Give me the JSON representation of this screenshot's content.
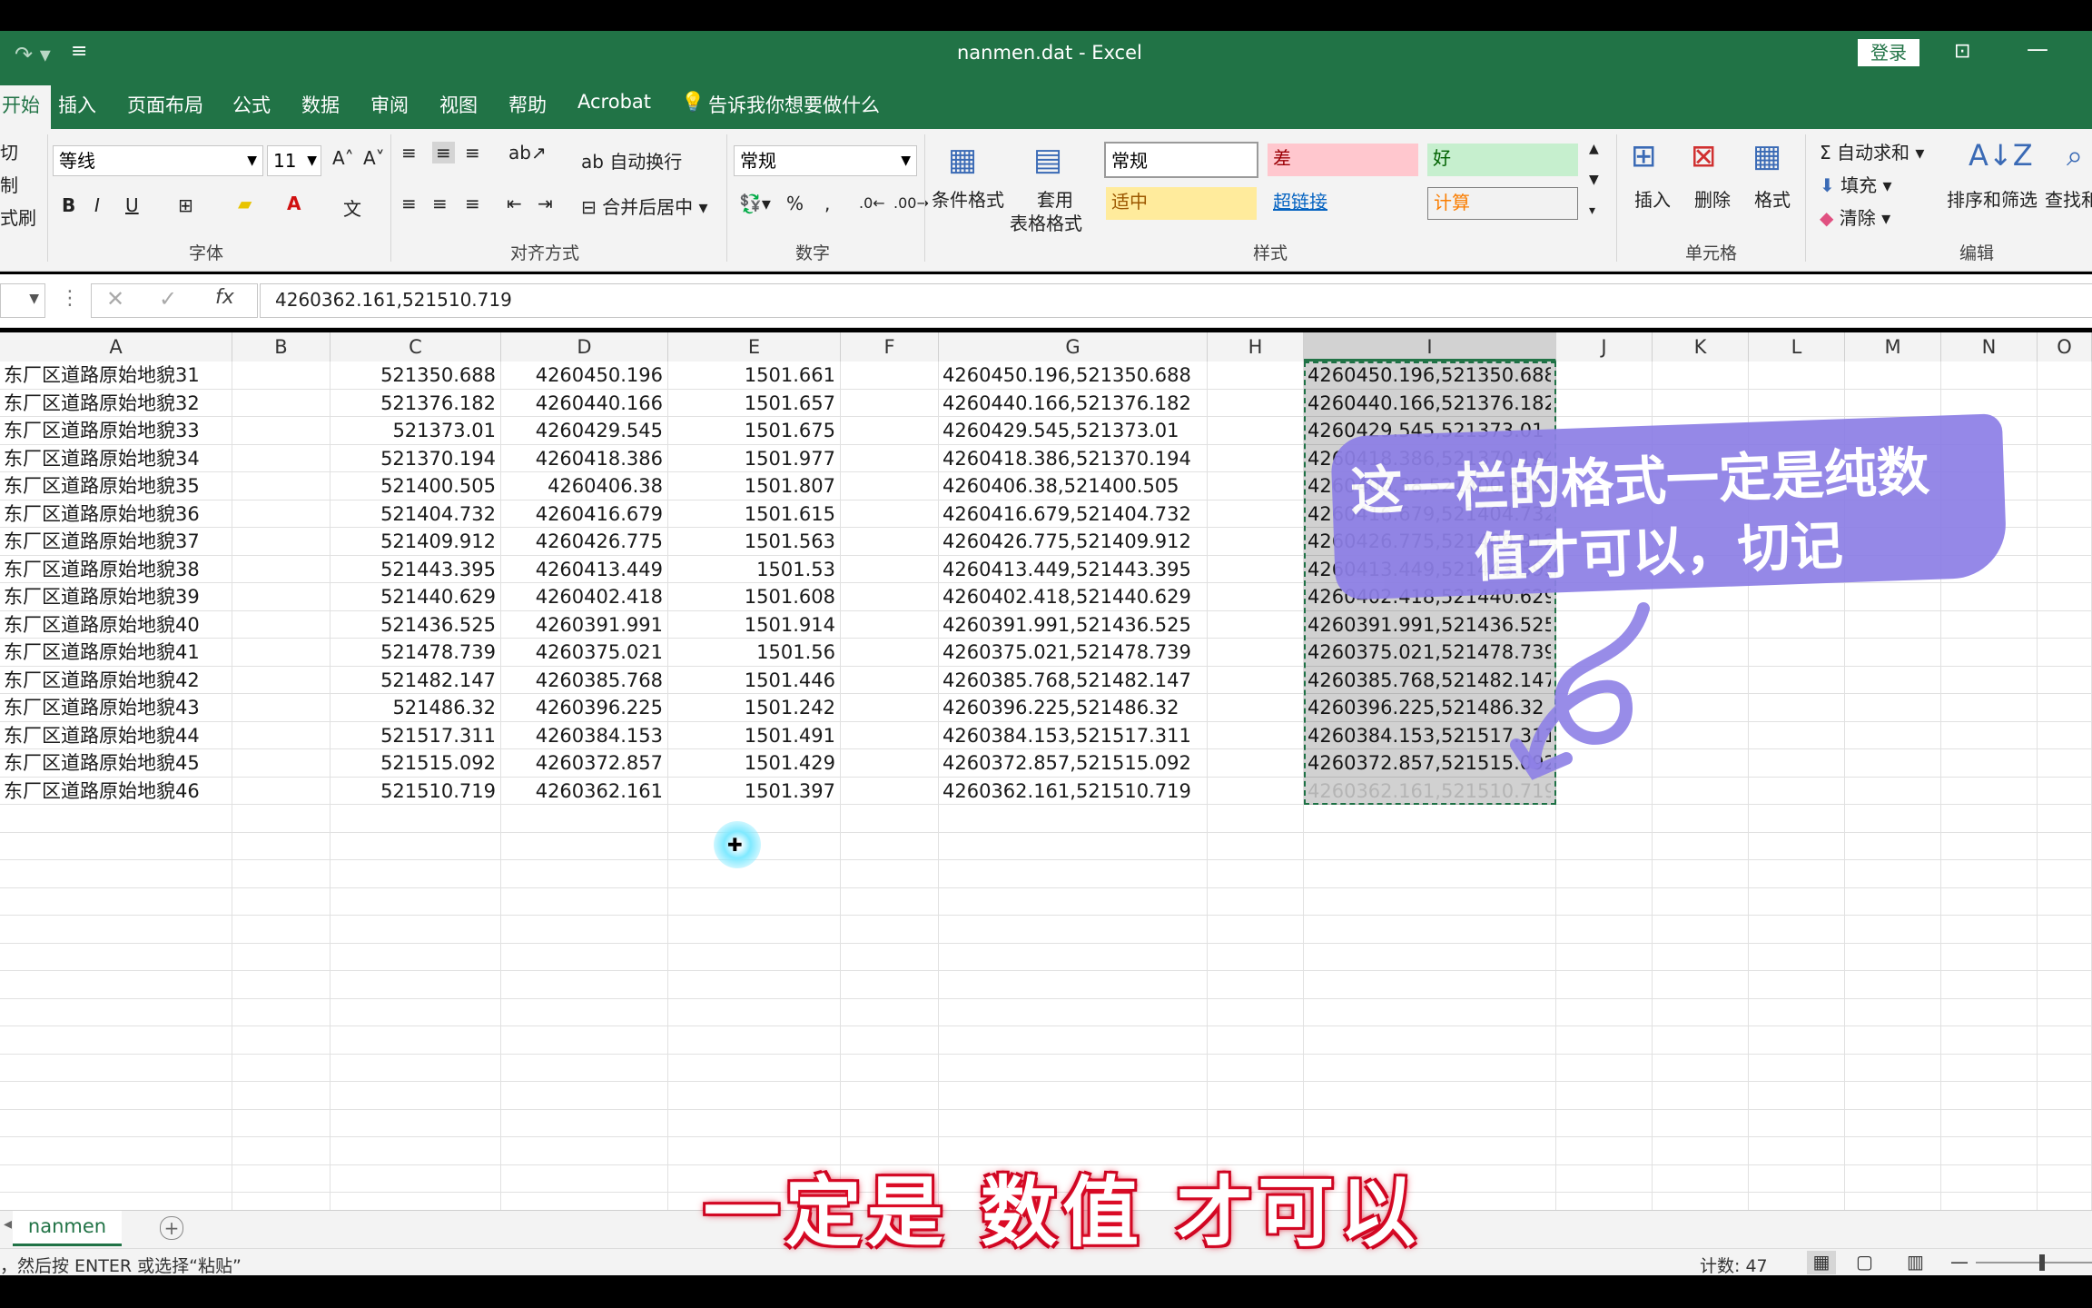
{
  "window": {
    "title": "nanmen.dat  -  Excel",
    "login": "登录"
  },
  "menu": {
    "items": [
      "开始",
      "插入",
      "页面布局",
      "公式",
      "数据",
      "审阅",
      "视图",
      "帮助",
      "Acrobat"
    ],
    "tellme": "告诉我你想要做什么"
  },
  "ribbon": {
    "clipboard": {
      "cut": "切",
      "copy": "制",
      "format_painter": "式刷"
    },
    "font": {
      "name": "等线",
      "size": "11",
      "label": "字体",
      "bold": "B",
      "italic": "I",
      "underline": "U"
    },
    "align": {
      "wrap": "自动换行",
      "merge": "合并后居中",
      "label": "对齐方式"
    },
    "number": {
      "format": "常规",
      "percent": "%",
      "comma": ",",
      "label": "数字"
    },
    "styles": {
      "conditional": "条件格式",
      "table_line1": "套用",
      "table_line2": "表格格式",
      "label": "样式",
      "cells": [
        "常规",
        "差",
        "好",
        "适中",
        "超链接",
        "计算"
      ]
    },
    "cells": {
      "insert": "插入",
      "delete": "删除",
      "format": "格式",
      "label": "单元格"
    },
    "editing": {
      "autosum": "自动求和",
      "fill": "填充",
      "clear": "清除",
      "sort": "排序和筛选",
      "find": "查找和",
      "label": "编辑"
    }
  },
  "formula": {
    "fx": "fx",
    "value": "4260362.161,521510.719"
  },
  "columns": [
    "A",
    "B",
    "C",
    "D",
    "E",
    "F",
    "G",
    "H",
    "I",
    "J",
    "K",
    "L",
    "M",
    "N",
    "O"
  ],
  "rows": [
    [
      "东厂区道路原始地貌31",
      "521350.688",
      "4260450.196",
      "1501.661",
      "4260450.196,521350.688",
      "4260450.196,521350.688"
    ],
    [
      "东厂区道路原始地貌32",
      "521376.182",
      "4260440.166",
      "1501.657",
      "4260440.166,521376.182",
      "4260440.166,521376.182"
    ],
    [
      "东厂区道路原始地貌33",
      "521373.01",
      "4260429.545",
      "1501.675",
      "4260429.545,521373.01",
      "4260429.545,521373.01"
    ],
    [
      "东厂区道路原始地貌34",
      "521370.194",
      "4260418.386",
      "1501.977",
      "4260418.386,521370.194",
      "4260418.386,521370.194"
    ],
    [
      "东厂区道路原始地貌35",
      "521400.505",
      "4260406.38",
      "1501.807",
      "4260406.38,521400.505",
      "4260406.38,521400.505"
    ],
    [
      "东厂区道路原始地貌36",
      "521404.732",
      "4260416.679",
      "1501.615",
      "4260416.679,521404.732",
      "4260416.679,521404.732"
    ],
    [
      "东厂区道路原始地貌37",
      "521409.912",
      "4260426.775",
      "1501.563",
      "4260426.775,521409.912",
      "4260426.775,521409.912"
    ],
    [
      "东厂区道路原始地貌38",
      "521443.395",
      "4260413.449",
      "1501.53",
      "4260413.449,521443.395",
      "4260413.449,521443.395"
    ],
    [
      "东厂区道路原始地貌39",
      "521440.629",
      "4260402.418",
      "1501.608",
      "4260402.418,521440.629",
      "4260402.418,521440.629"
    ],
    [
      "东厂区道路原始地貌40",
      "521436.525",
      "4260391.991",
      "1501.914",
      "4260391.991,521436.525",
      "4260391.991,521436.525"
    ],
    [
      "东厂区道路原始地貌41",
      "521478.739",
      "4260375.021",
      "1501.56",
      "4260375.021,521478.739",
      "4260375.021,521478.739"
    ],
    [
      "东厂区道路原始地貌42",
      "521482.147",
      "4260385.768",
      "1501.446",
      "4260385.768,521482.147",
      "4260385.768,521482.147"
    ],
    [
      "东厂区道路原始地貌43",
      "521486.32",
      "4260396.225",
      "1501.242",
      "4260396.225,521486.32",
      "4260396.225,521486.32"
    ],
    [
      "东厂区道路原始地貌44",
      "521517.311",
      "4260384.153",
      "1501.491",
      "4260384.153,521517.311",
      "4260384.153,521517.311"
    ],
    [
      "东厂区道路原始地貌45",
      "521515.092",
      "4260372.857",
      "1501.429",
      "4260372.857,521515.092",
      "4260372.857,521515.092"
    ],
    [
      "东厂区道路原始地貌46",
      "521510.719",
      "4260362.161",
      "1501.397",
      "4260362.161,521510.719",
      "4260362.161,521510.719"
    ]
  ],
  "sheet": {
    "tab": "nanmen",
    "add": "+"
  },
  "status": {
    "message": "，然后按 ENTER 或选择“粘贴”",
    "count": "计数: 47"
  },
  "annotation": {
    "line1": "这一栏的格式一定是纯数",
    "line2": "值才可以，切记"
  },
  "subtitle": "一定是 数值 才可以",
  "colors": {
    "excel_green": "#217346",
    "selection_border": "#1e7145",
    "annotation_purple": "#8d7fe6"
  }
}
